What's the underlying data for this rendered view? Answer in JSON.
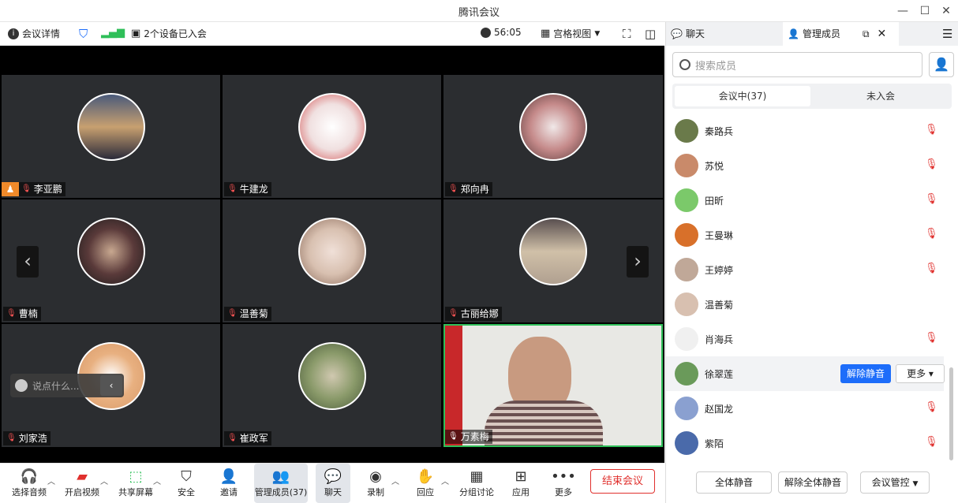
{
  "window": {
    "title": "腾讯会议"
  },
  "topbar": {
    "info": "会议详情",
    "devices": "2个设备已入会",
    "timer": "56:05",
    "view": "宫格视图"
  },
  "tiles": [
    {
      "name": "李亚鹏",
      "color": "#3a4a6a"
    },
    {
      "name": "牛建龙",
      "color": "#d04a4a"
    },
    {
      "name": "郑向冉",
      "color": "#c58a8a"
    },
    {
      "name": "曹楠",
      "color": "#5a3a3a"
    },
    {
      "name": "温善菊",
      "color": "#d8c0b0"
    },
    {
      "name": "古丽给娜",
      "color": "#b0a090"
    },
    {
      "name": "刘家浩",
      "color": "#d89a6a"
    },
    {
      "name": "崔政军",
      "color": "#6a8a4a"
    },
    {
      "name": "万素梅",
      "color": "#e8e8e4"
    }
  ],
  "chat_input": {
    "placeholder": "说点什么..."
  },
  "toolbar": {
    "audio": "选择音频",
    "video": "开启视频",
    "share": "共享屏幕",
    "security": "安全",
    "invite": "邀请",
    "members": "管理成员(37)",
    "chat": "聊天",
    "record": "录制",
    "reaction": "回应",
    "breakout": "分组讨论",
    "apps": "应用",
    "more": "更多",
    "end": "结束会议"
  },
  "panel": {
    "tab_chat": "聊天",
    "tab_members": "管理成员",
    "search_placeholder": "搜索成员",
    "seg_in": "会议中(37)",
    "seg_out": "未入会",
    "members": [
      {
        "name": "秦路兵",
        "muted": true,
        "color": "#6a7a4a"
      },
      {
        "name": "苏悦",
        "muted": true,
        "color": "#c98a6a"
      },
      {
        "name": "田昕",
        "muted": true,
        "color": "#7bc96a"
      },
      {
        "name": "王曼琳",
        "muted": true,
        "color": "#d8702a"
      },
      {
        "name": "王婷婷",
        "muted": true,
        "color": "#c0a898"
      },
      {
        "name": "温善菊",
        "muted": false,
        "color": "#d8c0b0"
      },
      {
        "name": "肖海兵",
        "muted": true,
        "color": "#f0f0f0"
      },
      {
        "name": "徐翠莲",
        "muted": false,
        "color": "#6a9a5a"
      },
      {
        "name": "赵国龙",
        "muted": true,
        "color": "#8aa0d0"
      },
      {
        "name": "紫陌",
        "muted": true,
        "color": "#4a6aaa"
      }
    ],
    "unmute": "解除静音",
    "more": "更多",
    "mute_all": "全体静音",
    "unmute_all": "解除全体静音",
    "control": "会议管控"
  }
}
